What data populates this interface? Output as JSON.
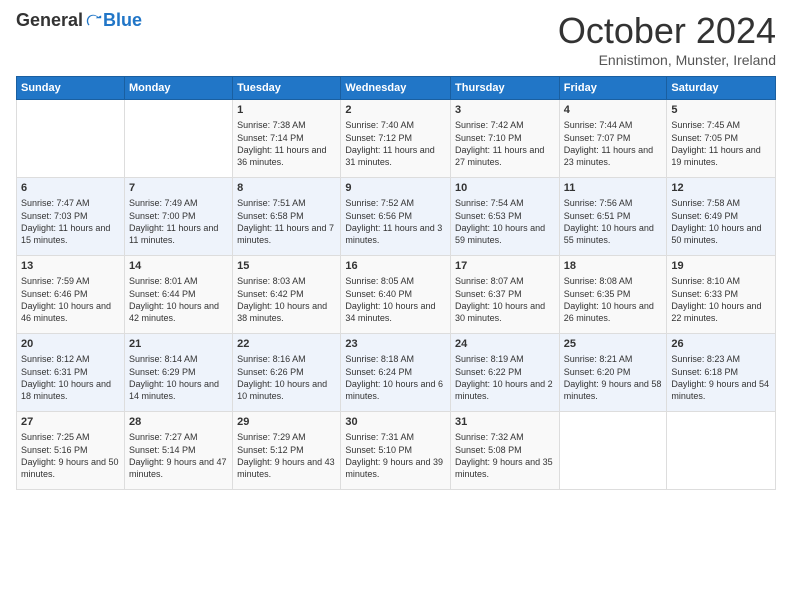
{
  "header": {
    "logo_general": "General",
    "logo_blue": "Blue",
    "month_title": "October 2024",
    "subtitle": "Ennistimon, Munster, Ireland"
  },
  "calendar": {
    "days_of_week": [
      "Sunday",
      "Monday",
      "Tuesday",
      "Wednesday",
      "Thursday",
      "Friday",
      "Saturday"
    ],
    "weeks": [
      [
        {
          "day": "",
          "content": ""
        },
        {
          "day": "",
          "content": ""
        },
        {
          "day": "1",
          "content": "Sunrise: 7:38 AM\nSunset: 7:14 PM\nDaylight: 11 hours and 36 minutes."
        },
        {
          "day": "2",
          "content": "Sunrise: 7:40 AM\nSunset: 7:12 PM\nDaylight: 11 hours and 31 minutes."
        },
        {
          "day": "3",
          "content": "Sunrise: 7:42 AM\nSunset: 7:10 PM\nDaylight: 11 hours and 27 minutes."
        },
        {
          "day": "4",
          "content": "Sunrise: 7:44 AM\nSunset: 7:07 PM\nDaylight: 11 hours and 23 minutes."
        },
        {
          "day": "5",
          "content": "Sunrise: 7:45 AM\nSunset: 7:05 PM\nDaylight: 11 hours and 19 minutes."
        }
      ],
      [
        {
          "day": "6",
          "content": "Sunrise: 7:47 AM\nSunset: 7:03 PM\nDaylight: 11 hours and 15 minutes."
        },
        {
          "day": "7",
          "content": "Sunrise: 7:49 AM\nSunset: 7:00 PM\nDaylight: 11 hours and 11 minutes."
        },
        {
          "day": "8",
          "content": "Sunrise: 7:51 AM\nSunset: 6:58 PM\nDaylight: 11 hours and 7 minutes."
        },
        {
          "day": "9",
          "content": "Sunrise: 7:52 AM\nSunset: 6:56 PM\nDaylight: 11 hours and 3 minutes."
        },
        {
          "day": "10",
          "content": "Sunrise: 7:54 AM\nSunset: 6:53 PM\nDaylight: 10 hours and 59 minutes."
        },
        {
          "day": "11",
          "content": "Sunrise: 7:56 AM\nSunset: 6:51 PM\nDaylight: 10 hours and 55 minutes."
        },
        {
          "day": "12",
          "content": "Sunrise: 7:58 AM\nSunset: 6:49 PM\nDaylight: 10 hours and 50 minutes."
        }
      ],
      [
        {
          "day": "13",
          "content": "Sunrise: 7:59 AM\nSunset: 6:46 PM\nDaylight: 10 hours and 46 minutes."
        },
        {
          "day": "14",
          "content": "Sunrise: 8:01 AM\nSunset: 6:44 PM\nDaylight: 10 hours and 42 minutes."
        },
        {
          "day": "15",
          "content": "Sunrise: 8:03 AM\nSunset: 6:42 PM\nDaylight: 10 hours and 38 minutes."
        },
        {
          "day": "16",
          "content": "Sunrise: 8:05 AM\nSunset: 6:40 PM\nDaylight: 10 hours and 34 minutes."
        },
        {
          "day": "17",
          "content": "Sunrise: 8:07 AM\nSunset: 6:37 PM\nDaylight: 10 hours and 30 minutes."
        },
        {
          "day": "18",
          "content": "Sunrise: 8:08 AM\nSunset: 6:35 PM\nDaylight: 10 hours and 26 minutes."
        },
        {
          "day": "19",
          "content": "Sunrise: 8:10 AM\nSunset: 6:33 PM\nDaylight: 10 hours and 22 minutes."
        }
      ],
      [
        {
          "day": "20",
          "content": "Sunrise: 8:12 AM\nSunset: 6:31 PM\nDaylight: 10 hours and 18 minutes."
        },
        {
          "day": "21",
          "content": "Sunrise: 8:14 AM\nSunset: 6:29 PM\nDaylight: 10 hours and 14 minutes."
        },
        {
          "day": "22",
          "content": "Sunrise: 8:16 AM\nSunset: 6:26 PM\nDaylight: 10 hours and 10 minutes."
        },
        {
          "day": "23",
          "content": "Sunrise: 8:18 AM\nSunset: 6:24 PM\nDaylight: 10 hours and 6 minutes."
        },
        {
          "day": "24",
          "content": "Sunrise: 8:19 AM\nSunset: 6:22 PM\nDaylight: 10 hours and 2 minutes."
        },
        {
          "day": "25",
          "content": "Sunrise: 8:21 AM\nSunset: 6:20 PM\nDaylight: 9 hours and 58 minutes."
        },
        {
          "day": "26",
          "content": "Sunrise: 8:23 AM\nSunset: 6:18 PM\nDaylight: 9 hours and 54 minutes."
        }
      ],
      [
        {
          "day": "27",
          "content": "Sunrise: 7:25 AM\nSunset: 5:16 PM\nDaylight: 9 hours and 50 minutes."
        },
        {
          "day": "28",
          "content": "Sunrise: 7:27 AM\nSunset: 5:14 PM\nDaylight: 9 hours and 47 minutes."
        },
        {
          "day": "29",
          "content": "Sunrise: 7:29 AM\nSunset: 5:12 PM\nDaylight: 9 hours and 43 minutes."
        },
        {
          "day": "30",
          "content": "Sunrise: 7:31 AM\nSunset: 5:10 PM\nDaylight: 9 hours and 39 minutes."
        },
        {
          "day": "31",
          "content": "Sunrise: 7:32 AM\nSunset: 5:08 PM\nDaylight: 9 hours and 35 minutes."
        },
        {
          "day": "",
          "content": ""
        },
        {
          "day": "",
          "content": ""
        }
      ]
    ]
  }
}
